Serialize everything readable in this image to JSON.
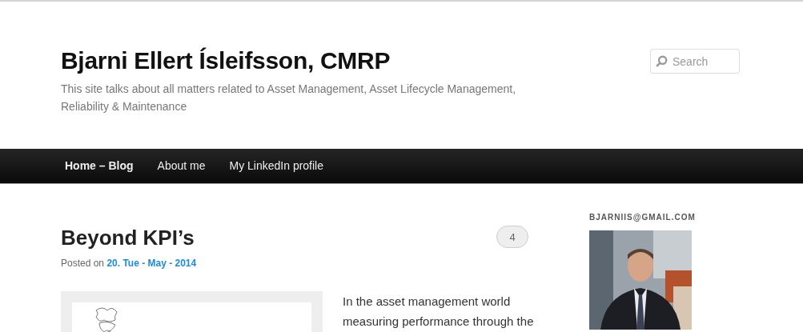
{
  "site": {
    "title": "Bjarni Ellert Ísleifsson, CMRP",
    "tagline": "This site talks about all matters related to Asset Management, Asset Lifecycle Management, Reliability & Maintenance"
  },
  "search": {
    "placeholder": "Search"
  },
  "nav": [
    {
      "label": "Home – Blog",
      "selected": true
    },
    {
      "label": "About me",
      "selected": false
    },
    {
      "label": "My LinkedIn profile",
      "selected": false
    }
  ],
  "post": {
    "title": "Beyond KPI’s",
    "posted_label": "Posted on",
    "date": "20. Tue - May - 2014",
    "comments": "4",
    "image": {
      "kind": "picture"
    },
    "excerpt_lines": [
      "In the asset management world",
      "measuring performance through the"
    ]
  },
  "sidebar": {
    "heading": "BJARNIIS@GMAIL.COM",
    "photo": {
      "kind": "picture"
    }
  }
}
